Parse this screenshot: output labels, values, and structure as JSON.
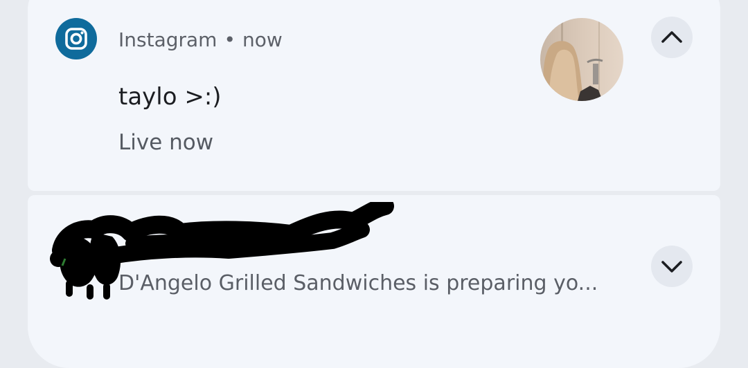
{
  "notification_instagram": {
    "app_name": "Instagram",
    "separator": "•",
    "time": "now",
    "title": "taylo >:)",
    "body": "Live now",
    "app_icon": "instagram-icon",
    "action_icon": "chevron-up-icon",
    "accent_color": "#0f6b9c"
  },
  "notification_dangelo": {
    "body": "D'Angelo Grilled Sandwiches is preparing yo...",
    "action_icon": "chevron-down-icon",
    "redacted": true
  }
}
